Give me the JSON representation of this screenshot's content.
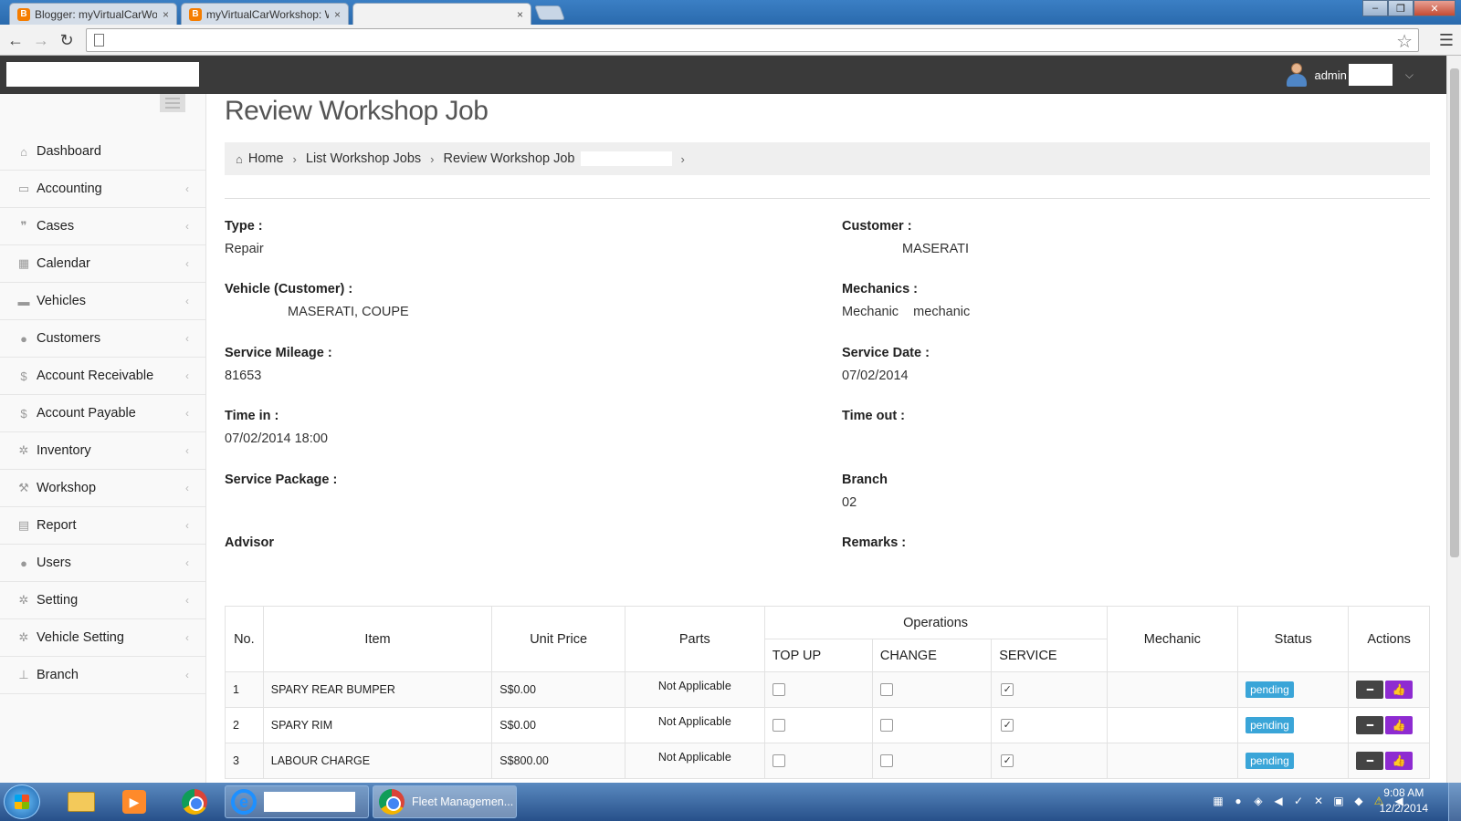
{
  "browser": {
    "tabs": [
      {
        "title": "Blogger: myVirtualCarWor",
        "favicon": "B"
      },
      {
        "title": "myVirtualCarWorkshop: W",
        "favicon": "B"
      },
      {
        "title": ""
      }
    ],
    "close_glyph": "×"
  },
  "header": {
    "username": "admin"
  },
  "sidebar": {
    "items": [
      {
        "label": "Dashboard",
        "icon": "dashboard-icon"
      },
      {
        "label": "Accounting",
        "icon": "credit-card-icon"
      },
      {
        "label": "Cases",
        "icon": "comments-icon"
      },
      {
        "label": "Calendar",
        "icon": "calendar-icon"
      },
      {
        "label": "Vehicles",
        "icon": "truck-icon"
      },
      {
        "label": "Customers",
        "icon": "users-icon"
      },
      {
        "label": "Account Receivable",
        "icon": "dollar-icon"
      },
      {
        "label": "Account Payable",
        "icon": "dollar-icon"
      },
      {
        "label": "Inventory",
        "icon": "gear-icon"
      },
      {
        "label": "Workshop",
        "icon": "wrench-icon"
      },
      {
        "label": "Report",
        "icon": "file-icon"
      },
      {
        "label": "Users",
        "icon": "user-icon"
      },
      {
        "label": "Setting",
        "icon": "gears-icon"
      },
      {
        "label": "Vehicle Setting",
        "icon": "gears-icon"
      },
      {
        "label": "Branch",
        "icon": "sitemap-icon"
      }
    ]
  },
  "page": {
    "title": "Review Workshop Job",
    "breadcrumb": {
      "home": "Home",
      "list": "List Workshop Jobs",
      "current": "Review Workshop Job"
    }
  },
  "details": {
    "type_label": "Type :",
    "type_value": "Repair",
    "customer_label": "Customer :",
    "customer_value": "MASERATI",
    "vehicle_label": "Vehicle (Customer) :",
    "vehicle_value": "MASERATI, COUPE",
    "mechanics_label": "Mechanics :",
    "mechanics_value": "Mechanic    mechanic",
    "mileage_label": "Service Mileage :",
    "mileage_value": "81653",
    "service_date_label": "Service Date :",
    "service_date_value": "07/02/2014",
    "time_in_label": "Time in :",
    "time_in_value": "07/02/2014 18:00",
    "time_out_label": "Time out :",
    "time_out_value": "",
    "package_label": "Service Package :",
    "package_value": "",
    "branch_label": "Branch",
    "branch_value": "02",
    "advisor_label": "Advisor",
    "advisor_value": "",
    "remarks_label": "Remarks :",
    "remarks_value": ""
  },
  "table": {
    "headers": {
      "no": "No.",
      "item": "Item",
      "unit_price": "Unit Price",
      "parts": "Parts",
      "operations": "Operations",
      "top_up": "TOP UP",
      "change": "CHANGE",
      "service": "SERVICE",
      "mechanic": "Mechanic",
      "status": "Status",
      "actions": "Actions"
    },
    "rows": [
      {
        "no": "1",
        "item": "SPARY REAR BUMPER",
        "unit_price": "S$0.00",
        "parts": "Not Applicable",
        "top_up": false,
        "change": false,
        "service": true,
        "mechanic": "",
        "status": "pending"
      },
      {
        "no": "2",
        "item": "SPARY RIM",
        "unit_price": "S$0.00",
        "parts": "Not Applicable",
        "top_up": false,
        "change": false,
        "service": true,
        "mechanic": "",
        "status": "pending"
      },
      {
        "no": "3",
        "item": "LABOUR CHARGE",
        "unit_price": "S$800.00",
        "parts": "Not Applicable",
        "top_up": false,
        "change": false,
        "service": true,
        "mechanic": "",
        "status": "pending"
      }
    ]
  },
  "taskbar": {
    "window_title": "Fleet Managemen...",
    "time": "9:08 AM",
    "date": "12/2/2014"
  },
  "colors": {
    "header_bg": "#3a3a3a",
    "badge": "#3aa5d8",
    "like_button": "#8e2bd1"
  }
}
